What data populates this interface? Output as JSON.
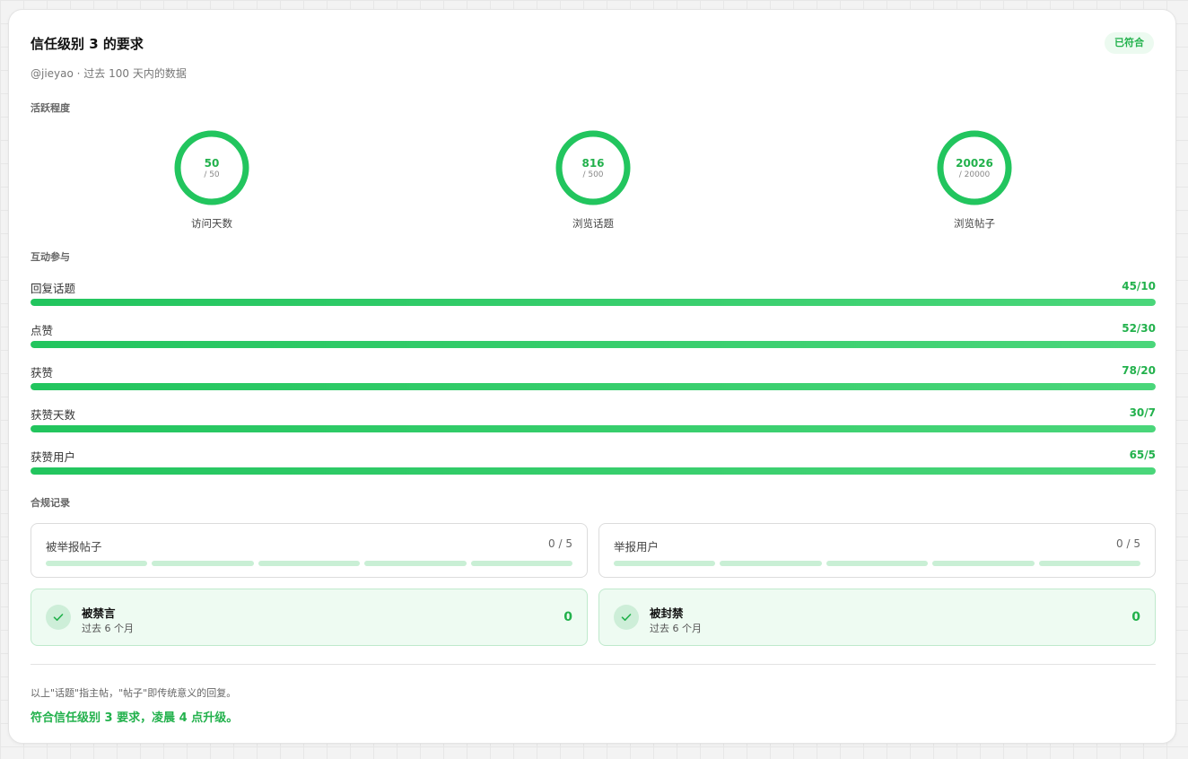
{
  "header": {
    "title": "信任级别 3 的要求",
    "badge": "已符合",
    "subtitle": "@jieyao · 过去 100 天内的数据"
  },
  "activity": {
    "heading": "活跃程度",
    "rings": [
      {
        "value": "50",
        "target": "/ 50",
        "label": "访问天数",
        "progress": 1.0
      },
      {
        "value": "816",
        "target": "/ 500",
        "label": "浏览话题",
        "progress": 1.0
      },
      {
        "value": "20026",
        "target": "/ 20000",
        "label": "浏览帖子",
        "progress": 1.0
      }
    ]
  },
  "engagement": {
    "heading": "互动参与",
    "bars": [
      {
        "label": "回复话题",
        "value": "45/10",
        "progress": 1.0
      },
      {
        "label": "点赞",
        "value": "52/30",
        "progress": 1.0
      },
      {
        "label": "获赞",
        "value": "78/20",
        "progress": 1.0
      },
      {
        "label": "获赞天数",
        "value": "30/7",
        "progress": 1.0
      },
      {
        "label": "获赞用户",
        "value": "65/5",
        "progress": 1.0
      }
    ]
  },
  "compliance": {
    "heading": "合规记录",
    "reports": [
      {
        "label": "被举报帖子",
        "value": "0 / 5"
      },
      {
        "label": "举报用户",
        "value": "0 / 5"
      }
    ],
    "bans": [
      {
        "title": "被禁言",
        "sub": "过去 6 个月",
        "count": "0"
      },
      {
        "title": "被封禁",
        "sub": "过去 6 个月",
        "count": "0"
      }
    ]
  },
  "footer": {
    "note": "以上\"话题\"指主帖，\"帖子\"即传统意义的回复。",
    "conclusion": "符合信任级别 3 要求，凌晨 4 点升级。"
  },
  "colors": {
    "accent": "#22c55e",
    "accent_text": "#22b14c"
  }
}
